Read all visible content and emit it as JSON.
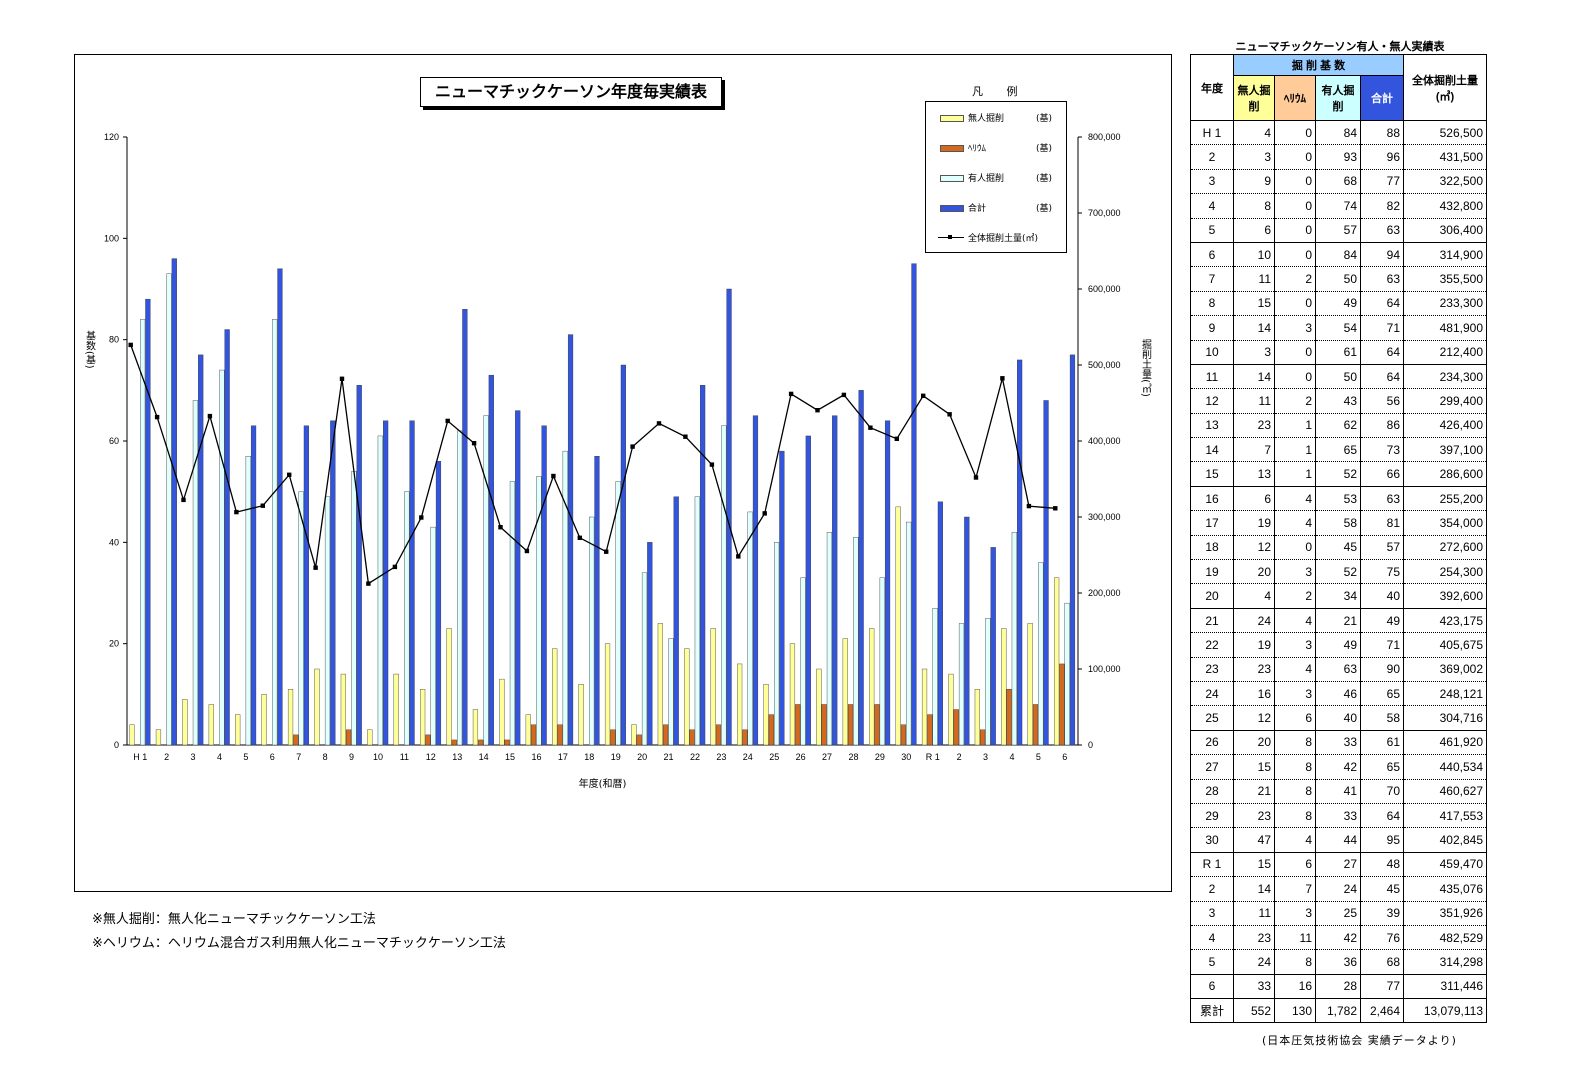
{
  "chart_data": {
    "type": "bar",
    "title": "ニューマチックケーソン年度毎実績表",
    "xlabel": "年度(和暦)",
    "ylabel": "基数(基)",
    "y2label": "掘削土量(㎥)",
    "ylim": [
      0,
      120
    ],
    "y2lim": [
      0,
      800000
    ],
    "yticks": [
      "0",
      "20",
      "40",
      "60",
      "80",
      "100",
      "120"
    ],
    "y2ticks": [
      "0",
      "100,000",
      "200,000",
      "300,000",
      "400,000",
      "500,000",
      "600,000",
      "700,000",
      "800,000"
    ],
    "categories": [
      "H 1",
      "2",
      "3",
      "4",
      "5",
      "6",
      "7",
      "8",
      "9",
      "10",
      "11",
      "12",
      "13",
      "14",
      "15",
      "16",
      "17",
      "18",
      "19",
      "20",
      "21",
      "22",
      "23",
      "24",
      "25",
      "26",
      "27",
      "28",
      "29",
      "30",
      "R 1",
      "2",
      "3",
      "4",
      "5",
      "6"
    ],
    "series": [
      {
        "name": "無人掘削",
        "unit": "(基)",
        "color": "#FFFF99",
        "values": [
          4,
          3,
          9,
          8,
          6,
          10,
          11,
          15,
          14,
          3,
          14,
          11,
          23,
          7,
          13,
          6,
          19,
          12,
          20,
          4,
          24,
          19,
          23,
          16,
          12,
          20,
          15,
          21,
          23,
          47,
          15,
          14,
          11,
          23,
          24,
          33
        ]
      },
      {
        "name": "ﾍﾘｳﾑ",
        "unit": "(基)",
        "color": "#D2691E",
        "values": [
          0,
          0,
          0,
          0,
          0,
          0,
          2,
          0,
          3,
          0,
          0,
          2,
          1,
          1,
          1,
          4,
          4,
          0,
          3,
          2,
          4,
          3,
          4,
          3,
          6,
          8,
          8,
          8,
          8,
          4,
          6,
          7,
          3,
          11,
          8,
          16
        ]
      },
      {
        "name": "有人掘削",
        "unit": "(基)",
        "color": "#E0FFFF",
        "values": [
          84,
          93,
          68,
          74,
          57,
          84,
          50,
          49,
          54,
          61,
          50,
          43,
          62,
          65,
          52,
          53,
          58,
          45,
          52,
          34,
          21,
          49,
          63,
          46,
          40,
          33,
          42,
          41,
          33,
          44,
          27,
          24,
          25,
          42,
          36,
          28
        ]
      },
      {
        "name": "合計",
        "unit": "(基)",
        "color": "#3355DD",
        "values": [
          88,
          96,
          77,
          82,
          63,
          94,
          63,
          64,
          71,
          64,
          64,
          56,
          86,
          73,
          66,
          63,
          81,
          57,
          75,
          40,
          49,
          71,
          90,
          65,
          58,
          61,
          65,
          70,
          64,
          95,
          48,
          45,
          39,
          76,
          68,
          77
        ]
      },
      {
        "name": "全体掘削土量(㎥)",
        "type": "line",
        "axis": "right",
        "color": "#000000",
        "values": [
          526500,
          431500,
          322500,
          432800,
          306400,
          314900,
          355500,
          233300,
          481900,
          212400,
          234300,
          299400,
          426400,
          397100,
          286600,
          255200,
          354000,
          272600,
          254300,
          392600,
          423175,
          405675,
          369002,
          248121,
          304716,
          461920,
          440534,
          460627,
          417553,
          402845,
          459470,
          435076,
          351926,
          482529,
          314298,
          311446
        ]
      }
    ],
    "legend_title": "凡 例",
    "legend_position": "top-right",
    "grid": false
  },
  "table": {
    "title": "ニューマチックケーソン有人・無人実績表",
    "headers": {
      "year": "年度",
      "group": "掘 削 基 数",
      "unmanned": "無人掘削",
      "helium": "ﾍﾘｳﾑ",
      "manned": "有人掘削",
      "total": "合計",
      "volume": "全体掘削土量(㎥)"
    },
    "rows": [
      [
        "H 1",
        "4",
        "0",
        "84",
        "88",
        "526,500"
      ],
      [
        "2",
        "3",
        "0",
        "93",
        "96",
        "431,500"
      ],
      [
        "3",
        "9",
        "0",
        "68",
        "77",
        "322,500"
      ],
      [
        "4",
        "8",
        "0",
        "74",
        "82",
        "432,800"
      ],
      [
        "5",
        "6",
        "0",
        "57",
        "63",
        "306,400"
      ],
      [
        "6",
        "10",
        "0",
        "84",
        "94",
        "314,900"
      ],
      [
        "7",
        "11",
        "2",
        "50",
        "63",
        "355,500"
      ],
      [
        "8",
        "15",
        "0",
        "49",
        "64",
        "233,300"
      ],
      [
        "9",
        "14",
        "3",
        "54",
        "71",
        "481,900"
      ],
      [
        "10",
        "3",
        "0",
        "61",
        "64",
        "212,400"
      ],
      [
        "11",
        "14",
        "0",
        "50",
        "64",
        "234,300"
      ],
      [
        "12",
        "11",
        "2",
        "43",
        "56",
        "299,400"
      ],
      [
        "13",
        "23",
        "1",
        "62",
        "86",
        "426,400"
      ],
      [
        "14",
        "7",
        "1",
        "65",
        "73",
        "397,100"
      ],
      [
        "15",
        "13",
        "1",
        "52",
        "66",
        "286,600"
      ],
      [
        "16",
        "6",
        "4",
        "53",
        "63",
        "255,200"
      ],
      [
        "17",
        "19",
        "4",
        "58",
        "81",
        "354,000"
      ],
      [
        "18",
        "12",
        "0",
        "45",
        "57",
        "272,600"
      ],
      [
        "19",
        "20",
        "3",
        "52",
        "75",
        "254,300"
      ],
      [
        "20",
        "4",
        "2",
        "34",
        "40",
        "392,600"
      ],
      [
        "21",
        "24",
        "4",
        "21",
        "49",
        "423,175"
      ],
      [
        "22",
        "19",
        "3",
        "49",
        "71",
        "405,675"
      ],
      [
        "23",
        "23",
        "4",
        "63",
        "90",
        "369,002"
      ],
      [
        "24",
        "16",
        "3",
        "46",
        "65",
        "248,121"
      ],
      [
        "25",
        "12",
        "6",
        "40",
        "58",
        "304,716"
      ],
      [
        "26",
        "20",
        "8",
        "33",
        "61",
        "461,920"
      ],
      [
        "27",
        "15",
        "8",
        "42",
        "65",
        "440,534"
      ],
      [
        "28",
        "21",
        "8",
        "41",
        "70",
        "460,627"
      ],
      [
        "29",
        "23",
        "8",
        "33",
        "64",
        "417,553"
      ],
      [
        "30",
        "47",
        "4",
        "44",
        "95",
        "402,845"
      ],
      [
        "R 1",
        "15",
        "6",
        "27",
        "48",
        "459,470"
      ],
      [
        "2",
        "14",
        "7",
        "24",
        "45",
        "435,076"
      ],
      [
        "3",
        "11",
        "3",
        "25",
        "39",
        "351,926"
      ],
      [
        "4",
        "23",
        "11",
        "42",
        "76",
        "482,529"
      ],
      [
        "5",
        "24",
        "8",
        "36",
        "68",
        "314,298"
      ],
      [
        "6",
        "33",
        "16",
        "28",
        "77",
        "311,446"
      ]
    ],
    "total_row": [
      "累計",
      "552",
      "130",
      "1,782",
      "2,464",
      "13,079,113"
    ],
    "source": "(日本圧気技術協会 実績データより)"
  },
  "notes": [
    "※無人掘削：無人化ニューマチックケーソン工法",
    "※ヘリウム：ヘリウム混合ガス利用無人化ニューマチックケーソン工法"
  ]
}
